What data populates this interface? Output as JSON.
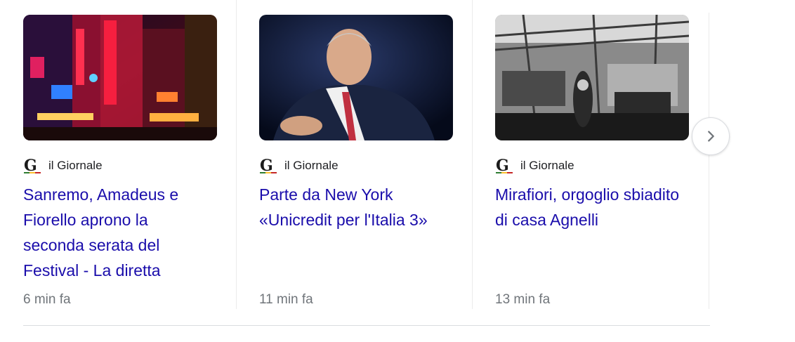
{
  "cards": [
    {
      "image_name": "sanremo-teatro-night-photo",
      "source": "il Giornale",
      "headline": "Sanremo, Amadeus e Fiorello aprono la seconda serata del Festival - La diretta",
      "time": "6 min fa"
    },
    {
      "image_name": "businessman-portrait-photo",
      "source": "il Giornale",
      "headline": "Parte da New York «Unicredit per l'Italia 3»",
      "time": "11 min fa"
    },
    {
      "image_name": "mirafiori-factory-bw-photo",
      "source": "il Giornale",
      "headline": "Mirafiori, orgoglio sbiadito di casa Agnelli",
      "time": "13 min fa"
    }
  ],
  "next_button": {
    "icon": "chevron-right-icon"
  },
  "colors": {
    "headline": "#1a0dab",
    "source_text": "#202124",
    "time_text": "#70757a",
    "divider": "#dadce0"
  }
}
